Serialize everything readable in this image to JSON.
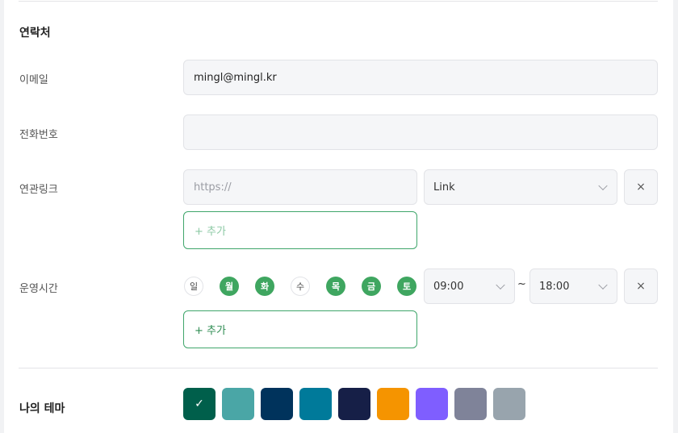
{
  "contact": {
    "section_title": "연락처",
    "email": {
      "label": "이메일",
      "value": "mingl@mingl.kr"
    },
    "phone": {
      "label": "전화번호",
      "value": ""
    },
    "links": {
      "label": "연관링크",
      "url_placeholder": "https://",
      "type_selected": "Link",
      "remove_symbol": "×",
      "add_label": "+ 추가"
    },
    "hours": {
      "label": "운영시간",
      "days": [
        {
          "label": "일",
          "active": false
        },
        {
          "label": "월",
          "active": true
        },
        {
          "label": "화",
          "active": true
        },
        {
          "label": "수",
          "active": false
        },
        {
          "label": "목",
          "active": true
        },
        {
          "label": "금",
          "active": true
        },
        {
          "label": "토",
          "active": true
        }
      ],
      "start_time": "09:00",
      "separator": "~",
      "end_time": "18:00",
      "remove_symbol": "×",
      "add_label": "+ 추가"
    }
  },
  "theme": {
    "section_title": "나의 테마",
    "check_symbol": "✓",
    "selected_index": 0,
    "swatches": [
      "#005f4b",
      "#4aa6a6",
      "#00335c",
      "#007a9a",
      "#161f47",
      "#f59400",
      "#7f5eff",
      "#7f8399",
      "#98a4ad"
    ]
  },
  "colors": {
    "accent_green": "#3fa660",
    "add_text_muted": "#8cc9a4",
    "add_text_active": "#2e8c52"
  }
}
